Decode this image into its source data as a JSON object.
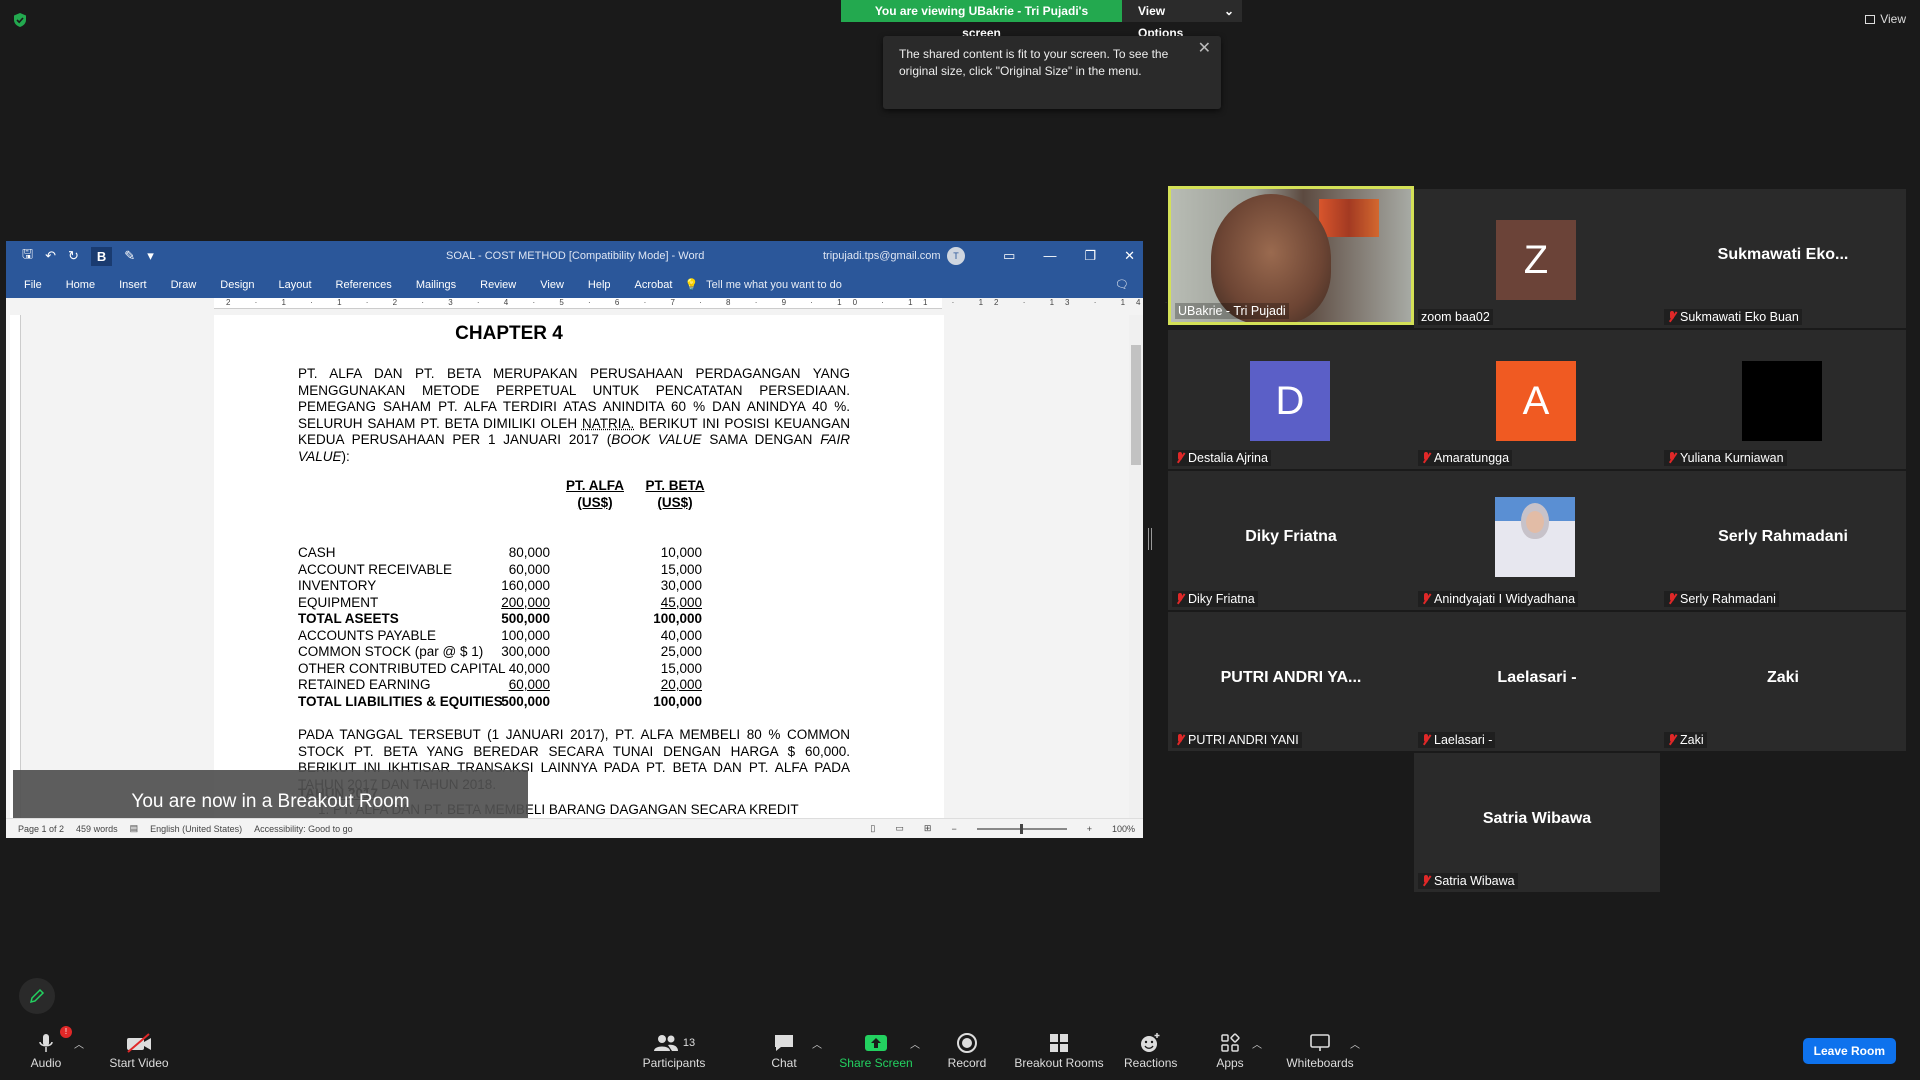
{
  "screen_share": {
    "banner": "You are viewing UBakrie - Tri Pujadi's screen",
    "view_options": "View Options",
    "tooltip": "The shared content is fit to your screen. To see the original size, click \"Original Size\" in the menu.",
    "top_view": "View"
  },
  "word": {
    "title": "SOAL - COST METHOD [Compatibility Mode]  -  Word",
    "user_email": "tripujadi.tps@gmail.com",
    "user_initial": "T",
    "menu": [
      "File",
      "Home",
      "Insert",
      "Draw",
      "Design",
      "Layout",
      "References",
      "Mailings",
      "Review",
      "View",
      "Help",
      "Acrobat"
    ],
    "tell_me": "Tell me what you want to do",
    "ruler": "2 · 1 · 1 · 2 · 3 · 4 · 5 · 6 · 7 · 8 · 9 · 10 · 11 · 12 · 13 · 14 · 15 · 16 · 17 · 18 · 19",
    "status": {
      "page": "Page 1 of 2",
      "words": "459 words",
      "language": "English (United States)",
      "accessibility": "Accessibility: Good to go",
      "zoom": "100%"
    },
    "doc": {
      "chapter": "CHAPTER 4",
      "para1_before_natria": "PT. ALFA DAN PT. BETA MERUPAKAN PERUSAHAAN PERDAGANGAN YANG MENGGUNAKAN METODE PERPETUAL UNTUK PENCATATAN PERSEDIAAN. PEMEGANG SAHAM PT. ALFA TERDIRI ATAS ANINDITA 60 % DAN ANINDYA 40 %. SELURUH SAHAM PT. BETA DIMILIKI OLEH ",
      "para1_natria": "NATRIA.",
      "para1_after_natria": " BERIKUT INI POSISI KEUANGAN KEDUA PERUSAHAAN PER 1 JANUARI 2017 (",
      "para1_book": "BOOK VALUE",
      "para1_sama": " SAMA DENGAN ",
      "para1_fair": "FAIR VALUE",
      "para1_end": "):",
      "col_alfa_1": "PT. ALFA",
      "col_alfa_2": "(US$)",
      "col_beta_1": "PT. BETA",
      "col_beta_2": "(US$)",
      "rows": [
        {
          "label": "CASH",
          "alfa": "80,000",
          "beta": "10,000"
        },
        {
          "label": "ACCOUNT RECEIVABLE",
          "alfa": "60,000",
          "beta": "15,000"
        },
        {
          "label": "INVENTORY",
          "alfa": "160,000",
          "beta": "30,000"
        },
        {
          "label": "EQUIPMENT",
          "alfa": "200,000",
          "beta": "45,000"
        },
        {
          "label": "TOTAL ASEETS",
          "alfa": "500,000",
          "beta": "100,000"
        },
        {
          "label": "ACCOUNTS PAYABLE",
          "alfa": "100,000",
          "beta": "40,000"
        },
        {
          "label": "COMMON STOCK (par @ $ 1)",
          "alfa": "300,000",
          "beta": "25,000"
        },
        {
          "label": "OTHER CONTRIBUTED CAPITAL",
          "alfa": "40,000",
          "beta": "15,000"
        },
        {
          "label": "RETAINED EARNING",
          "alfa": "60,000",
          "beta": "20,000"
        },
        {
          "label": "TOTAL LIABILITIES & EQUITIES",
          "alfa": "500,000",
          "beta": "100,000"
        }
      ],
      "para2": "PADA TANGGAL TERSEBUT (1 JANUARI 2017), PT. ALFA MEMBELI 80 % COMMON STOCK PT. BETA YANG BEREDAR SECARA TUNAI DENGAN HARGA $ 60,000. BERIKUT INI IKHTISAR TRANSAKSI LAINNYA PADA   PT. BETA DAN PT. ALFA PADA TAHUN 2017 DAN TAHUN 2018.",
      "tahun": "TAHUN 2017",
      "item1": "1.  PT. ALFA DAN PT. BETA MEMBELI BARANG DAGANGAN SECARA KREDIT"
    },
    "breakout_toast": "You are now in a Breakout Room"
  },
  "participants": [
    {
      "tile_name": "",
      "caption": "UBakrie - Tri Pujadi",
      "muted": false,
      "type": "video"
    },
    {
      "tile_name": "",
      "caption": "zoom baa02",
      "muted": false,
      "type": "letter",
      "letter": "Z",
      "color": "#6b4338"
    },
    {
      "tile_name": "Sukmawati  Eko...",
      "caption": "Sukmawati Eko Buan",
      "muted": true,
      "type": "name"
    },
    {
      "tile_name": "",
      "caption": "Destalia Ajrina",
      "muted": true,
      "type": "letter",
      "letter": "D",
      "color": "#5b5fc7"
    },
    {
      "tile_name": "",
      "caption": "Amaratungga",
      "muted": true,
      "type": "letter",
      "letter": "A",
      "color": "#f05a22"
    },
    {
      "tile_name": "",
      "caption": "Yuliana Kurniawan",
      "muted": true,
      "type": "black"
    },
    {
      "tile_name": "Diky Friatna",
      "caption": "Diky Friatna",
      "muted": true,
      "type": "name"
    },
    {
      "tile_name": "",
      "caption": "Anindyajati I Widyadhana",
      "muted": true,
      "type": "photo"
    },
    {
      "tile_name": "Serly Rahmadani",
      "caption": "Serly Rahmadani",
      "muted": true,
      "type": "name"
    },
    {
      "tile_name": "PUTRI  ANDRI  YA...",
      "caption": "PUTRI ANDRI YANI",
      "muted": true,
      "type": "name"
    },
    {
      "tile_name": "Laelasari -",
      "caption": "Laelasari -",
      "muted": true,
      "type": "name"
    },
    {
      "tile_name": "Zaki",
      "caption": "Zaki",
      "muted": true,
      "type": "name"
    },
    {
      "tile_name": "Satria Wibawa",
      "caption": "Satria Wibawa",
      "muted": true,
      "type": "name"
    }
  ],
  "toolbar": {
    "audio": "Audio",
    "start_video": "Start Video",
    "participants": "Participants",
    "participants_count": "13",
    "chat": "Chat",
    "share_screen": "Share Screen",
    "record": "Record",
    "breakout_rooms": "Breakout Rooms",
    "reactions": "Reactions",
    "apps": "Apps",
    "whiteboards": "Whiteboards",
    "leave_room": "Leave Room",
    "audio_badge": "!"
  },
  "colors": {
    "share_green": "#23a94f",
    "word_blue": "#2b579a",
    "leave_blue": "#0e72ed",
    "speaker_border": "#d4e157",
    "muted_red": "#e02828"
  }
}
